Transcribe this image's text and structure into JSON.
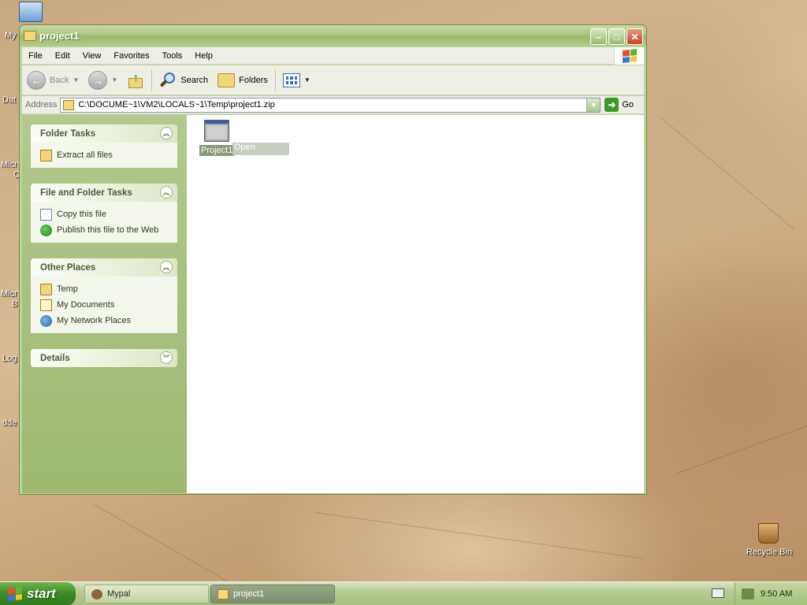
{
  "desktop": {
    "icon_labels": [
      "My",
      "Dat",
      "Micro",
      "C",
      "Micr",
      "B",
      "Log",
      "dde"
    ],
    "recycle_bin_label": "Recycle Bin"
  },
  "window": {
    "title": "project1",
    "menu": [
      "File",
      "Edit",
      "View",
      "Favorites",
      "Tools",
      "Help"
    ],
    "toolbar": {
      "back_label": "Back",
      "search_label": "Search",
      "folders_label": "Folders"
    },
    "address": {
      "label": "Address",
      "value": "C:\\DOCUME~1\\VM2\\LOCALS~1\\Temp\\project1.zip",
      "go_label": "Go"
    },
    "panels": {
      "folder_tasks": {
        "title": "Folder Tasks",
        "items": [
          "Extract all files"
        ]
      },
      "file_folder_tasks": {
        "title": "File and Folder Tasks",
        "items": [
          "Copy this file",
          "Publish this file to the Web"
        ]
      },
      "other_places": {
        "title": "Other Places",
        "items": [
          "Temp",
          "My Documents",
          "My Network Places"
        ]
      },
      "details": {
        "title": "Details"
      }
    },
    "content": {
      "file_label": "Project1",
      "context_hint": "Open"
    }
  },
  "taskbar": {
    "start_label": "start",
    "tasks": [
      "Mypal",
      "project1"
    ],
    "clock": "9:50 AM"
  },
  "colors": {
    "start_green": "#3b8a25",
    "title_olive": "#a9c47d",
    "pane_olive": "#9db86f"
  }
}
